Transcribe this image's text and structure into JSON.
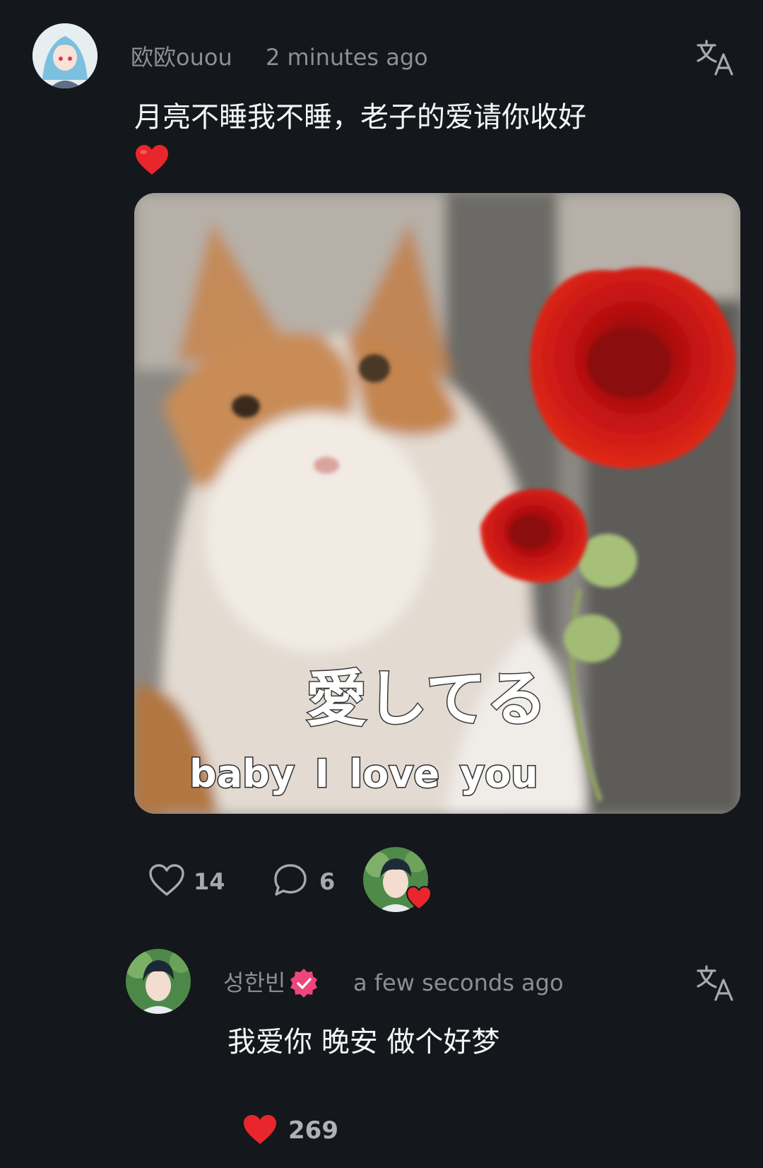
{
  "post": {
    "author": "欧欧ouou",
    "time": "2 minutes ago",
    "text_line1": "月亮不睡我不睡，老子的爱请你收好",
    "text_line2": "❤️",
    "image": {
      "caption_jp": "愛してる",
      "caption_en": "baby I love you"
    },
    "likes": "14",
    "comments": "6"
  },
  "reply": {
    "author": "성한빈",
    "time": "a few seconds ago",
    "text": "我爱你 晚安 做个好梦",
    "likes": "269"
  },
  "icons": {
    "translate": "translate-icon",
    "like": "heart-outline-icon",
    "comment": "comment-bubble-icon",
    "liked": "heart-filled-icon",
    "verified": "verified-badge-icon"
  },
  "colors": {
    "background": "#14171b",
    "meta_text": "#8e8e93",
    "heart_red": "#e8262c",
    "verified_pink": "#f0457a"
  }
}
